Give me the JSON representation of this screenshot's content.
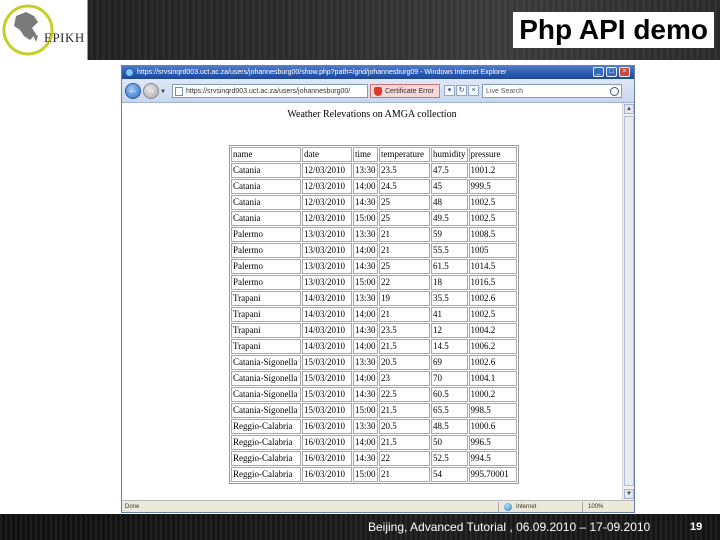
{
  "slide": {
    "title": "Php API demo",
    "logo_text": "EPIKH",
    "footer_text": "Beijing,  Advanced Tutorial , 06.09.2010 – 17-09.2010",
    "page_number": "19"
  },
  "browser": {
    "window_title": "https://srvsinqrd003.uct.ac.za/users/johannesburg00/show.php?path=/grid/johannesburg09 - Windows Internet Explorer",
    "address_url": "https://srvsinqrd003.uct.ac.za/users/johannesburg00/",
    "cert_label": "Certificate Error",
    "search_placeholder": "Live Search",
    "status_text": "Done",
    "status_zone": "Internet",
    "status_zoom": "100%",
    "back_icon": "left-arrow",
    "forward_icon": "right-arrow"
  },
  "page": {
    "heading": "Weather Relevations on AMGA collection",
    "columns": [
      "name",
      "date",
      "time",
      "temperature",
      "humidity",
      "pressure"
    ],
    "rows": [
      [
        "Catania",
        "12/03/2010",
        "13:30",
        "23.5",
        "47.5",
        "1001.2"
      ],
      [
        "Catania",
        "12/03/2010",
        "14:00",
        "24.5",
        "45",
        "999.5"
      ],
      [
        "Catania",
        "12/03/2010",
        "14:30",
        "25",
        "48",
        "1002.5"
      ],
      [
        "Catania",
        "12/03/2010",
        "15:00",
        "25",
        "49.5",
        "1002.5"
      ],
      [
        "Palermo",
        "13/03/2010",
        "13:30",
        "21",
        "59",
        "1008.5"
      ],
      [
        "Palermo",
        "13/03/2010",
        "14:00",
        "21",
        "55.5",
        "1005"
      ],
      [
        "Palermo",
        "13/03/2010",
        "14:30",
        "25",
        "61.5",
        "1014.5"
      ],
      [
        "Palermo",
        "13/03/2010",
        "15:00",
        "22",
        "18",
        "1016.5"
      ],
      [
        "Trapani",
        "14/03/2010",
        "13:30",
        "19",
        "35.5",
        "1002.6"
      ],
      [
        "Trapani",
        "14/03/2010",
        "14:00",
        "21",
        "41",
        "1002.5"
      ],
      [
        "Trapani",
        "14/03/2010",
        "14:30",
        "23.5",
        "12",
        "1004.2"
      ],
      [
        "Trapani",
        "14/03/2010",
        "14:00",
        "21.5",
        "14.5",
        "1006.2"
      ],
      [
        "Catania-Sigonella",
        "15/03/2010",
        "13:30",
        "20.5",
        "69",
        "1002.6"
      ],
      [
        "Catania-Sigonella",
        "15/03/2010",
        "14:00",
        "23",
        "70",
        "1004.1"
      ],
      [
        "Catania-Sigonella",
        "15/03/2010",
        "14:30",
        "22.5",
        "60.5",
        "1000.2"
      ],
      [
        "Catania-Sigonella",
        "15/03/2010",
        "15:00",
        "21.5",
        "65.5",
        "998.5"
      ],
      [
        "Reggio-Calabria",
        "16/03/2010",
        "13:30",
        "20.5",
        "48.5",
        "1000.6"
      ],
      [
        "Reggio-Calabria",
        "16/03/2010",
        "14:00",
        "21.5",
        "50",
        "996.5"
      ],
      [
        "Reggio-Calabria",
        "16/03/2010",
        "14:30",
        "22",
        "52.5",
        "994.5"
      ],
      [
        "Reggio-Calabria",
        "16/03/2010",
        "15:00",
        "21",
        "54",
        "995.70001"
      ]
    ]
  }
}
